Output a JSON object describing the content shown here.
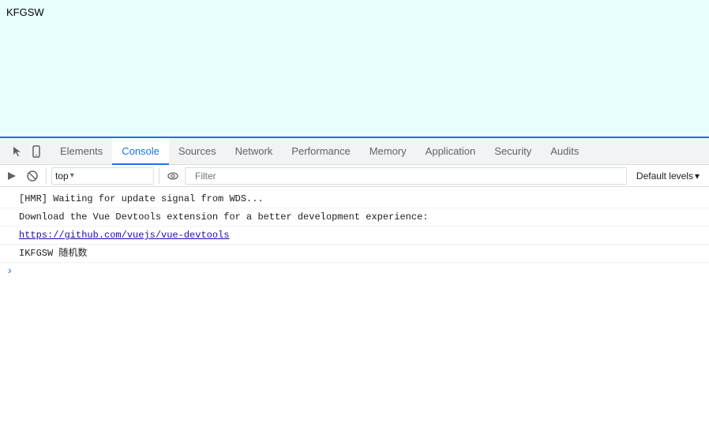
{
  "page": {
    "title": "KFGSW",
    "background": "#e8fffe"
  },
  "devtools": {
    "tabs": [
      {
        "id": "elements",
        "label": "Elements",
        "active": false
      },
      {
        "id": "console",
        "label": "Console",
        "active": true
      },
      {
        "id": "sources",
        "label": "Sources",
        "active": false
      },
      {
        "id": "network",
        "label": "Network",
        "active": false
      },
      {
        "id": "performance",
        "label": "Performance",
        "active": false
      },
      {
        "id": "memory",
        "label": "Memory",
        "active": false
      },
      {
        "id": "application",
        "label": "Application",
        "active": false
      },
      {
        "id": "security",
        "label": "Security",
        "active": false
      },
      {
        "id": "audits",
        "label": "Audits",
        "active": false
      }
    ],
    "toolbar": {
      "context": "top",
      "filter_placeholder": "Filter",
      "default_levels": "Default levels"
    },
    "console": {
      "lines": [
        {
          "type": "hmr",
          "text": "[HMR] Waiting for update signal from WDS..."
        },
        {
          "type": "download",
          "text": "Download the Vue Devtools extension for a better development experience:"
        },
        {
          "type": "link",
          "text": "https://github.com/vuejs/vue-devtools",
          "href": "https://github.com/vuejs/vue-devtools"
        },
        {
          "type": "random",
          "text": "IKFGSW 随机数"
        }
      ]
    }
  },
  "icons": {
    "cursor": "↖",
    "mobile": "▭",
    "console_error": "🚫",
    "eye": "👁",
    "chevron_down": "▾",
    "prompt_arrow": ">"
  }
}
